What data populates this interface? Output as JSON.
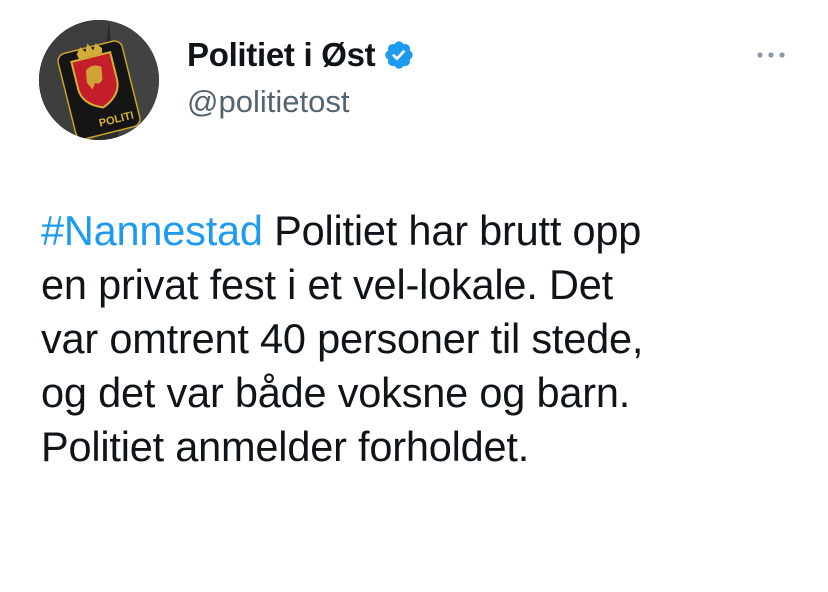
{
  "author": {
    "display_name": "Politiet i Øst",
    "handle": "@politietost",
    "verified": true,
    "avatar_badge_text": "POLITI"
  },
  "more_icon": "more-horizontal-icon",
  "tweet": {
    "hashtag": "#Nannestad",
    "line1_rest": " Politiet har brutt opp",
    "line2": "en privat fest i et vel-lokale. Det",
    "line3": "var omtrent 40 personer til stede,",
    "line4": "og det var både voksne og barn.",
    "line5": "Politiet anmelder forholdet."
  },
  "colors": {
    "link": "#1d9bf0",
    "verified_badge": "#1d9bf0",
    "secondary_text": "#536471",
    "primary_text": "#0f1419"
  }
}
